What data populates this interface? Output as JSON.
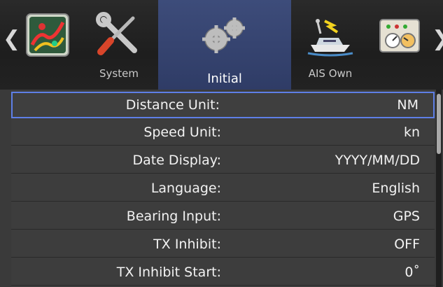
{
  "tabs": [
    {
      "label": "",
      "icon": "radar-chart-icon"
    },
    {
      "label": "System",
      "icon": "wrench-screwdriver-icon"
    },
    {
      "label": "Initial",
      "icon": "gears-icon",
      "selected": true
    },
    {
      "label": "AIS Own",
      "icon": "boat-antenna-icon"
    },
    {
      "label": "",
      "icon": "gauges-panel-icon"
    }
  ],
  "nav": {
    "left_arrow": "❮",
    "right_arrow": "❯"
  },
  "settings": [
    {
      "name": "Distance Unit:",
      "value": "NM"
    },
    {
      "name": "Speed Unit:",
      "value": "kn"
    },
    {
      "name": "Date Display:",
      "value": "YYYY/MM/DD"
    },
    {
      "name": "Language:",
      "value": "English"
    },
    {
      "name": "Bearing Input:",
      "value": "GPS"
    },
    {
      "name": "TX Inhibit:",
      "value": "OFF"
    },
    {
      "name": "TX Inhibit Start:",
      "value": "0˚"
    }
  ],
  "colors": {
    "selection_border": "#5e7fe6",
    "selected_tab": "#3d4c7a"
  }
}
